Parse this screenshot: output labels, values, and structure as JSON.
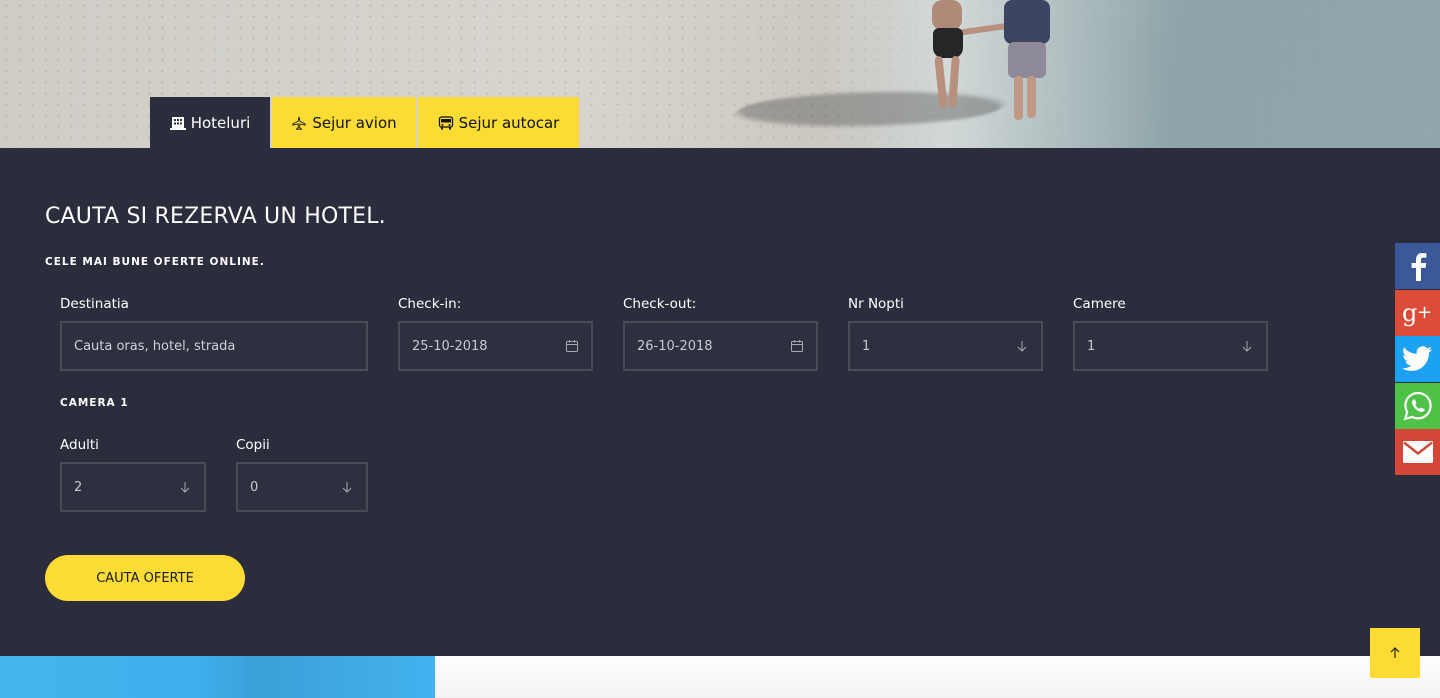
{
  "tabs": [
    {
      "label": "Hoteluri",
      "icon": "building-icon",
      "active": true
    },
    {
      "label": "Sejur avion",
      "icon": "plane-icon",
      "active": false
    },
    {
      "label": "Sejur autocar",
      "icon": "bus-icon",
      "active": false
    }
  ],
  "search": {
    "title": "CAUTA SI REZERVA UN HOTEL.",
    "subtitle": "CELE MAI BUNE OFERTE ONLINE.",
    "destination": {
      "label": "Destinatia",
      "placeholder": "Cauta oras, hotel, strada"
    },
    "checkin": {
      "label": "Check-in:",
      "value": "25-10-2018",
      "icon": "calendar-icon"
    },
    "checkout": {
      "label": "Check-out:",
      "value": "26-10-2018",
      "icon": "calendar-icon"
    },
    "nights": {
      "label": "Nr Nopti",
      "value": "1",
      "icon": "arrow-down-icon"
    },
    "rooms": {
      "label": "Camere",
      "value": "1",
      "icon": "arrow-down-icon"
    },
    "camera_label": "CAMERA 1",
    "adults": {
      "label": "Adulti",
      "value": "2",
      "icon": "arrow-down-icon"
    },
    "children": {
      "label": "Copii",
      "value": "0",
      "icon": "arrow-down-icon"
    },
    "button": "CAUTA OFERTE"
  },
  "social": [
    {
      "name": "facebook",
      "color": "#3b5998"
    },
    {
      "name": "google-plus",
      "color": "#dd4b39"
    },
    {
      "name": "twitter",
      "color": "#1da1f2"
    },
    {
      "name": "whatsapp",
      "color": "#4dc247"
    },
    {
      "name": "email",
      "color": "#d44638"
    }
  ],
  "colors": {
    "accent": "#fcdc34",
    "panel": "#2b2c3c",
    "field_border": "#4a4b59"
  }
}
